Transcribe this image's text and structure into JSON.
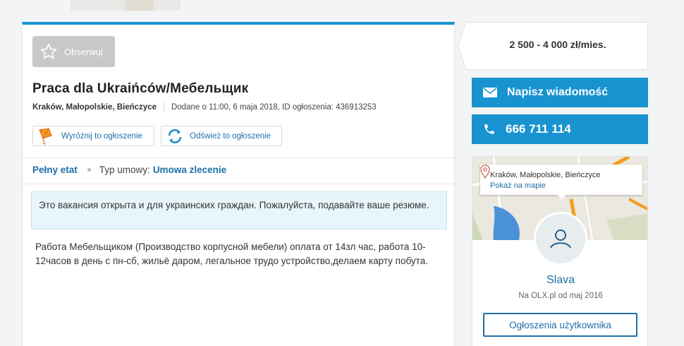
{
  "listing": {
    "observe_label": "Obserwuj",
    "title": "Praca dla Ukraińców/Мебельщик",
    "location": "Kraków, Małopolskie, Bieńczyce",
    "added": "Dodane o 11:00, 6 maja 2018, ID ogłoszenia: 436913253",
    "highlight_label": "Wyróżnij to ogłoszenie",
    "refresh_label": "Odśwież to ogłoszenie",
    "params": {
      "employment": "Pełny etat",
      "contract_label": "Typ umowy:",
      "contract_value": "Umowa zlecenie"
    },
    "notice": "Это вакансия открыта и для украинских граждан. Пожалуйста, подавайте ваше резюме.",
    "description": "Работа Мебельщиком (Производство корпусной мебели) оплата от 14зл час, работа 10-12часов в день с пн-сб, жильё даром, легальное трудо устройство,делаем карту побута."
  },
  "sidebar": {
    "price": "2 500 - 4 000 zł/mies.",
    "message_label": "Napisz wiadomość",
    "phone": "666 711 114",
    "map": {
      "address": "Kraków, Małopolskie, Bieńczyce",
      "show_on_map": "Pokaż na mapie"
    },
    "user": {
      "name": "Slava",
      "since": "Na OLX.pl od maj 2016",
      "ads_label": "Ogłoszenia użytkownika"
    }
  },
  "colors": {
    "accent": "#1893d0",
    "link": "#1f6fa8",
    "notice_bg": "#e8f5fb",
    "page_bg": "#f2f4f5"
  },
  "icons": [
    "star-icon",
    "kite-icon",
    "refresh-icon",
    "envelope-icon",
    "phone-icon",
    "map-pin-icon",
    "user-icon"
  ]
}
